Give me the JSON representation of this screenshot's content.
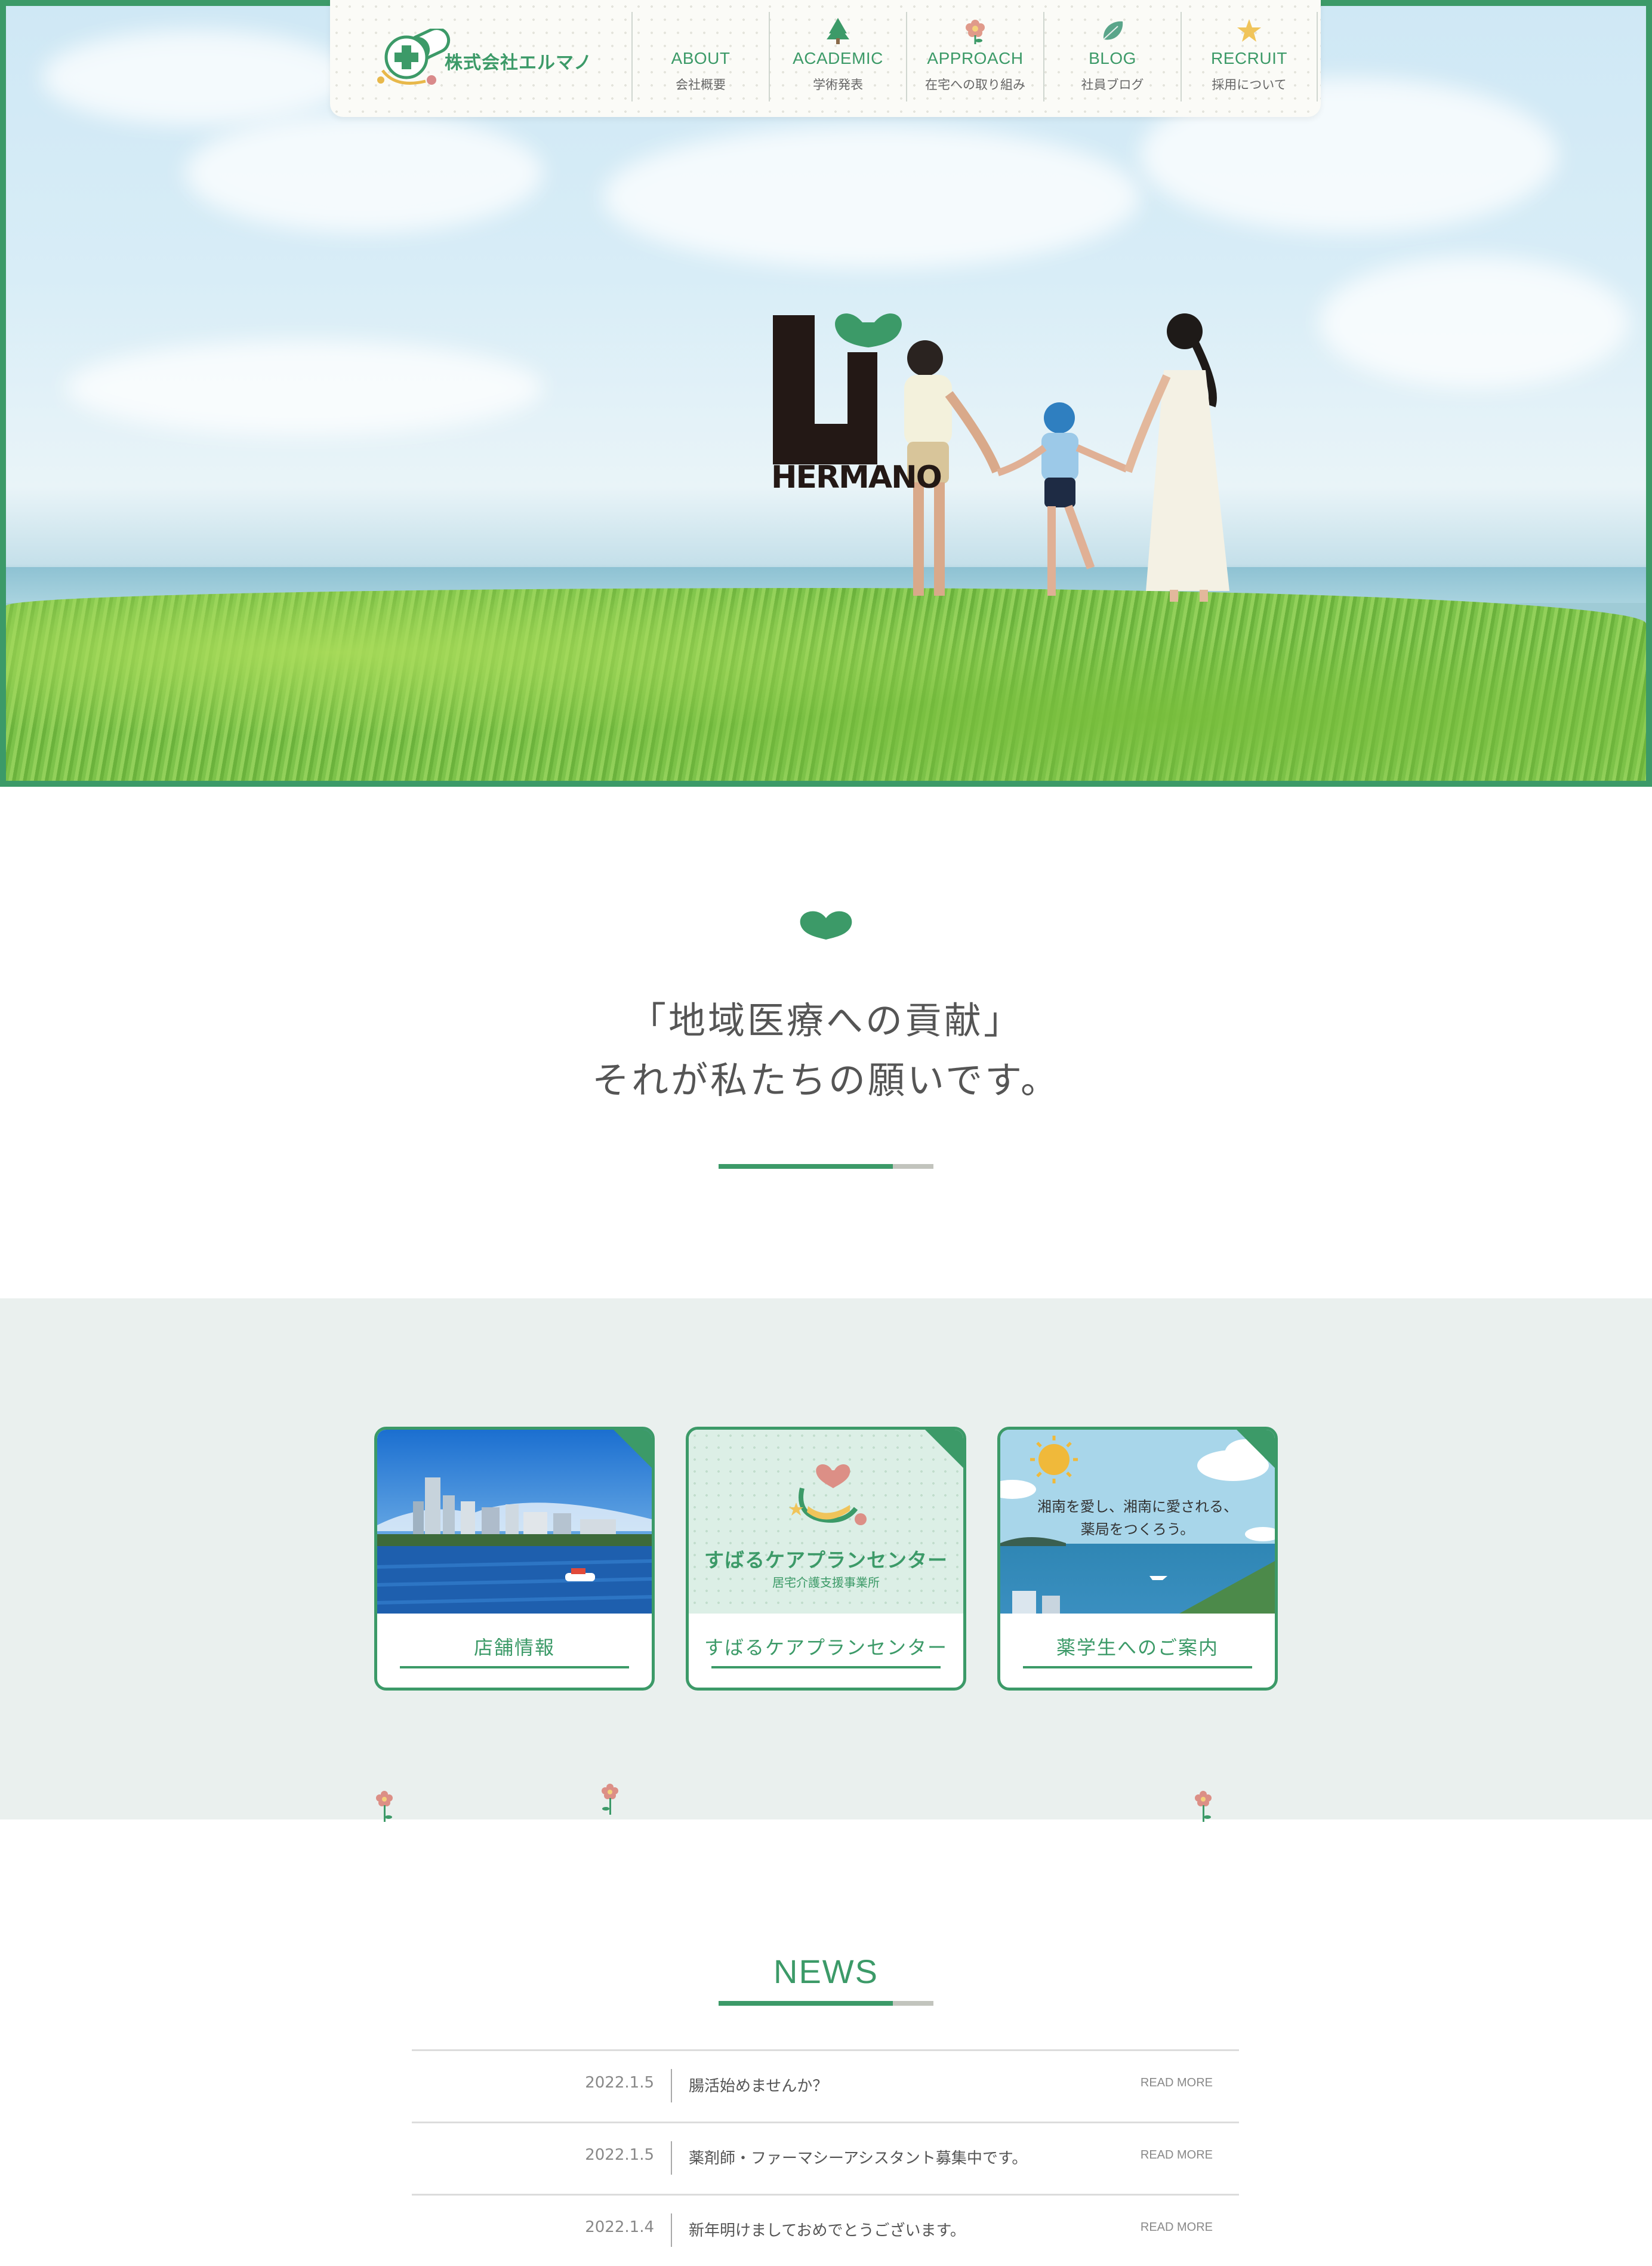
{
  "header": {
    "company_name": "株式会社エルマノ",
    "nav": [
      {
        "en": "ABOUT",
        "jp": "会社概要",
        "icon": "none"
      },
      {
        "en": "ACADEMIC",
        "jp": "学術発表",
        "icon": "tree-icon"
      },
      {
        "en": "APPROACH",
        "jp": "在宅への取り組み",
        "icon": "flower-icon"
      },
      {
        "en": "BLOG",
        "jp": "社員ブログ",
        "icon": "leaf-icon"
      },
      {
        "en": "RECRUIT",
        "jp": "採用について",
        "icon": "star-icon"
      }
    ]
  },
  "hero": {
    "logo_text": "HERMANO"
  },
  "message": {
    "line1": "「地域医療への貢献」",
    "line2": "それが私たちの願いです。"
  },
  "services": [
    {
      "label": "店舗情報",
      "image": "harbor-city-photo"
    },
    {
      "label": "すばるケアプランセンター",
      "image_title": "すばるケアプランセンター",
      "image_sub": "居宅介護支援事業所"
    },
    {
      "label": "薬学生へのご案内",
      "image_line1": "湘南を愛し、湘南に愛される、",
      "image_line2": "薬局をつくろう。"
    }
  ],
  "news": {
    "title": "NEWS",
    "read_more": "READ MORE",
    "items": [
      {
        "date": "2022.1.5",
        "text": "腸活始めませんか？"
      },
      {
        "date": "2022.1.5",
        "text": "薬剤師・ファーマシーアシスタント募集中です。"
      },
      {
        "date": "2022.1.4",
        "text": "新年明けましておめでとうございます。"
      }
    ]
  },
  "colors": {
    "brand_green": "#3c9a68",
    "band_bg": "#eaf0ee",
    "rule_gray": "#c2c4bd"
  }
}
